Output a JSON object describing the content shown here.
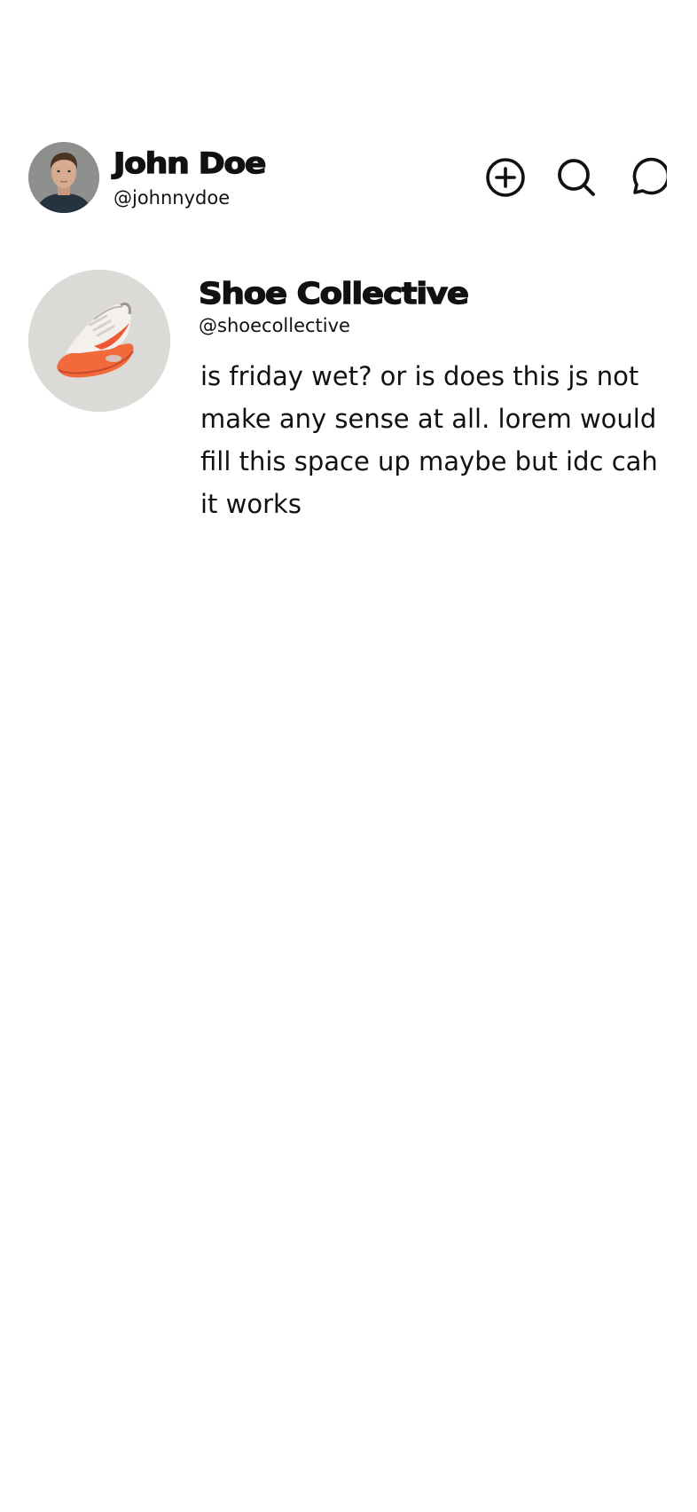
{
  "header": {
    "user": {
      "name": "John Doe",
      "handle": "@johnnydoe",
      "avatar_icon": "profile-photo"
    },
    "actions": [
      {
        "icon": "plus-circle-icon"
      },
      {
        "icon": "search-icon"
      },
      {
        "icon": "message-bubble-icon"
      }
    ]
  },
  "feed": {
    "posts": [
      {
        "author": "Shoe Collective",
        "handle": "@shoecollective",
        "avatar_icon": "sneaker-photo",
        "text": "is friday wet? or is does this js not make any sense at all. lorem would fill this space up maybe but idc cah it works"
      }
    ]
  },
  "colors": {
    "text": "#111111",
    "background": "#ffffff",
    "accent_sneaker": "#f2603f"
  }
}
